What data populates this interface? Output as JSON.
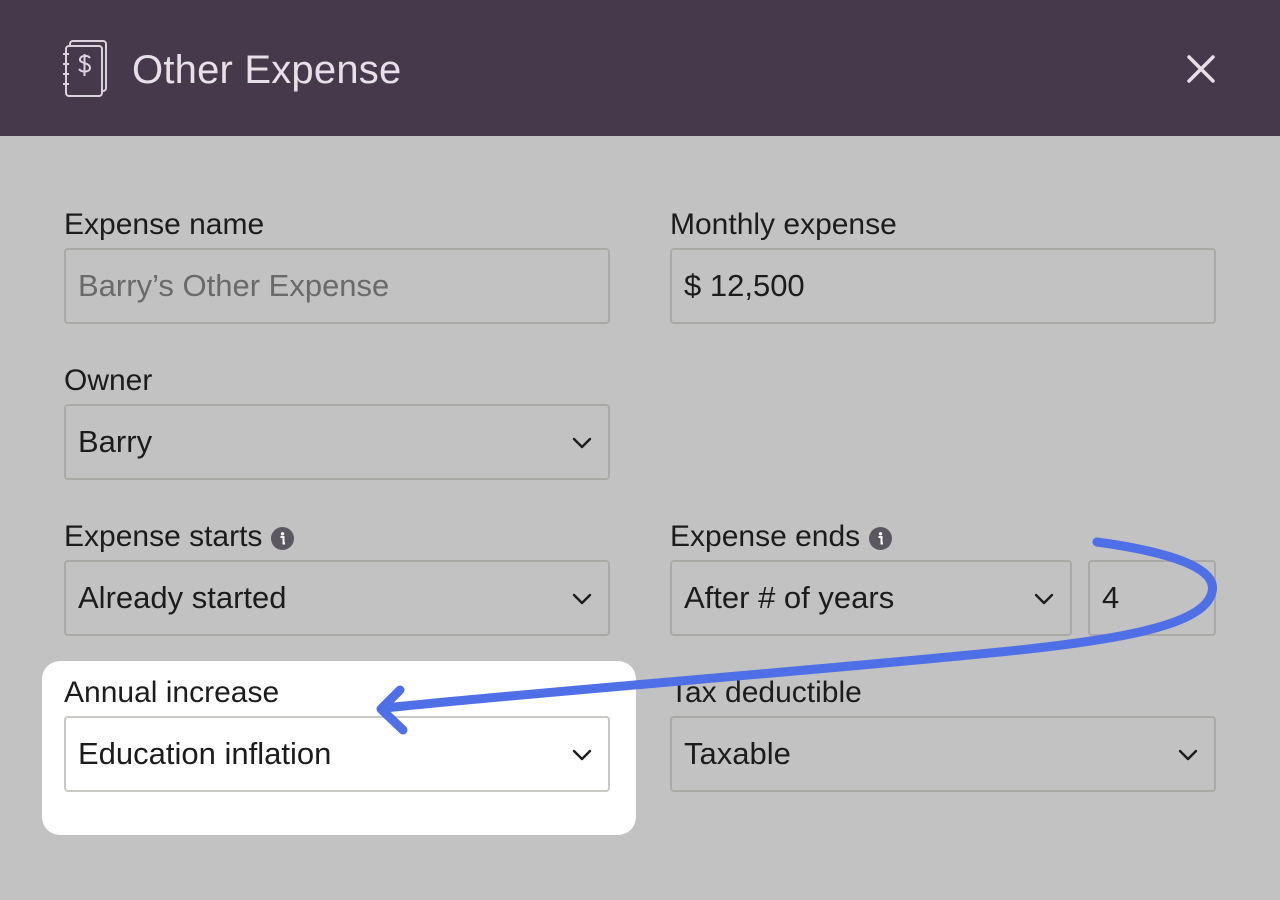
{
  "header": {
    "title": "Other Expense",
    "background": "#46394c",
    "logo_icon": "ledger-dollar-icon",
    "close_icon": "close-icon"
  },
  "form": {
    "expense_name": {
      "label": "Expense name",
      "placeholder": "Barry’s Other Expense"
    },
    "monthly_expense": {
      "label": "Monthly expense",
      "value": "$ 12,500"
    },
    "owner": {
      "label": "Owner",
      "value": "Barry"
    },
    "expense_starts": {
      "label": "Expense starts",
      "value": "Already started",
      "info_icon": "info-icon"
    },
    "expense_ends": {
      "label": "Expense ends",
      "value": "After # of years",
      "years": "4",
      "info_icon": "info-icon"
    },
    "annual_increase": {
      "label": "Annual increase",
      "value": "Education inflation"
    },
    "tax_deductible": {
      "label": "Tax deductible",
      "value": "Taxable"
    }
  },
  "annotation": {
    "arrow_color": "#4f6fe6",
    "highlight_color": "#ffffff"
  }
}
